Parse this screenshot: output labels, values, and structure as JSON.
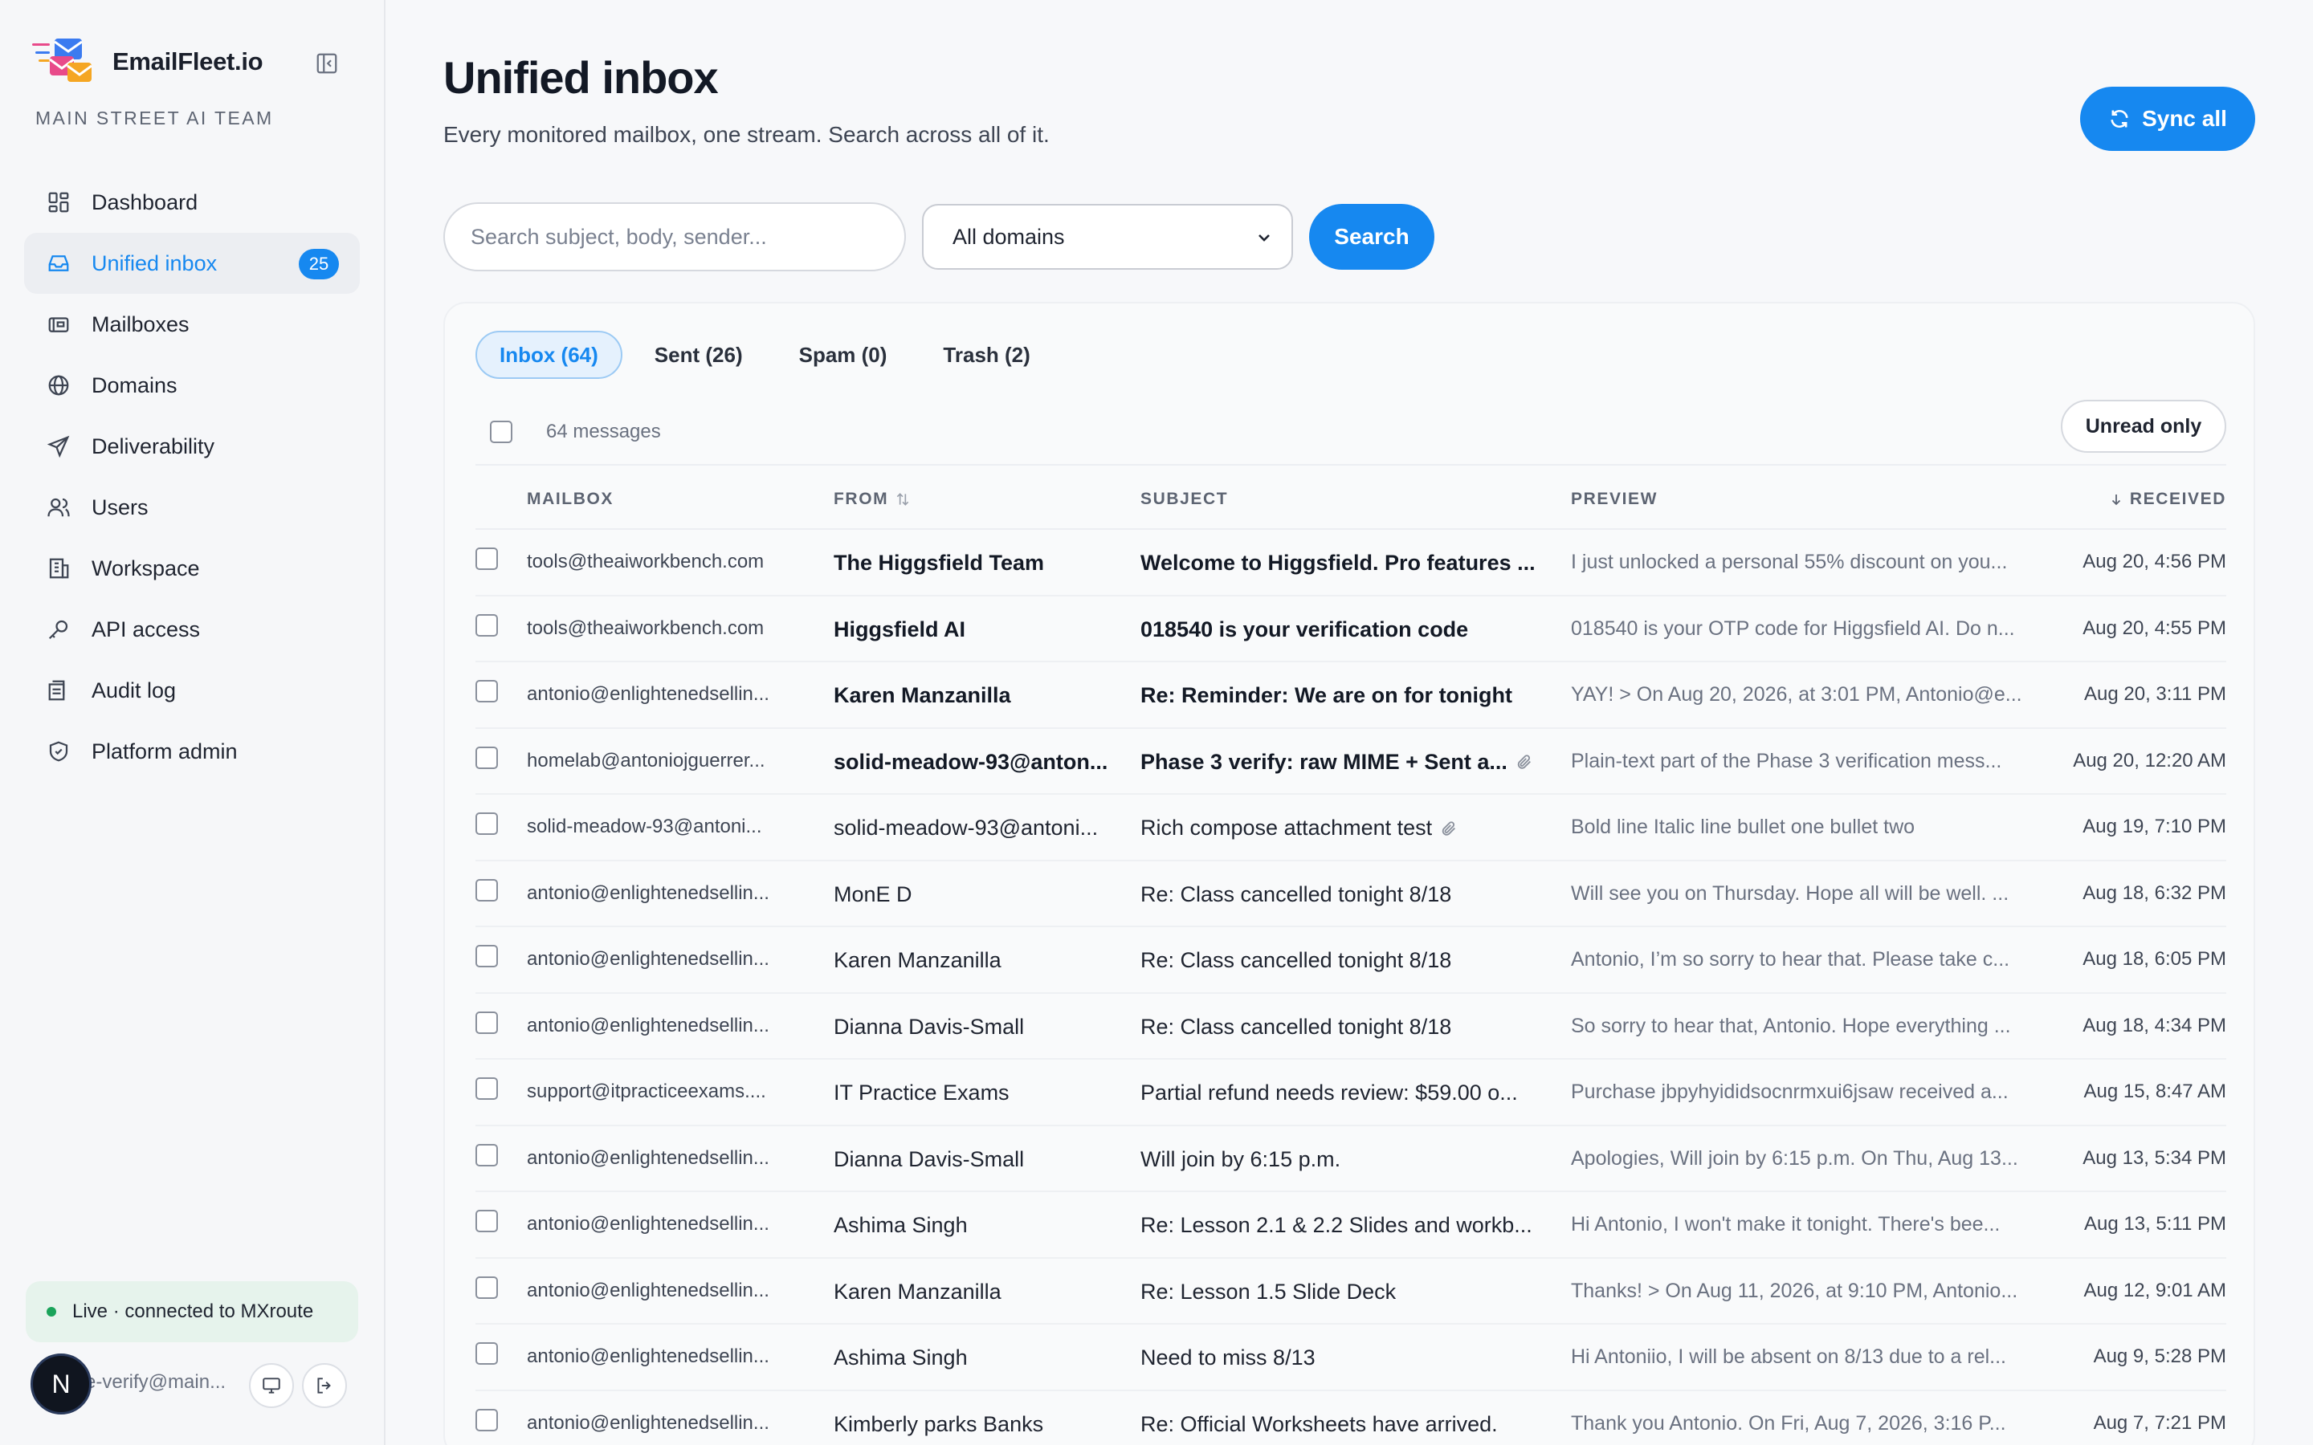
{
  "brand": {
    "name": "EmailFleet.io",
    "team": "MAIN STREET AI TEAM"
  },
  "colors": {
    "accent": "#1688f0",
    "status": "#1aa35a"
  },
  "nav": {
    "items": [
      {
        "label": "Dashboard",
        "icon": "dashboard-icon"
      },
      {
        "label": "Unified inbox",
        "icon": "inbox-icon",
        "badge": "25",
        "active": true
      },
      {
        "label": "Mailboxes",
        "icon": "mailbox-icon"
      },
      {
        "label": "Domains",
        "icon": "globe-icon"
      },
      {
        "label": "Deliverability",
        "icon": "send-icon"
      },
      {
        "label": "Users",
        "icon": "users-icon"
      },
      {
        "label": "Workspace",
        "icon": "building-icon"
      },
      {
        "label": "API access",
        "icon": "key-icon"
      },
      {
        "label": "Audit log",
        "icon": "log-icon"
      },
      {
        "label": "Platform admin",
        "icon": "shield-icon"
      }
    ]
  },
  "status": {
    "text": "Live · connected to MXroute"
  },
  "user": {
    "initial": "N",
    "email": "e-verify@main..."
  },
  "header": {
    "title": "Unified inbox",
    "subtitle": "Every monitored mailbox, one stream. Search across all of it.",
    "sync_label": "Sync all"
  },
  "search": {
    "placeholder": "Search subject, body, sender...",
    "domain_selected": "All domains",
    "button_label": "Search"
  },
  "tabs": [
    {
      "label": "Inbox (64)",
      "active": true
    },
    {
      "label": "Sent (26)"
    },
    {
      "label": "Spam (0)"
    },
    {
      "label": "Trash (2)"
    }
  ],
  "toolbar": {
    "count": "64 messages",
    "unread_label": "Unread only"
  },
  "table": {
    "columns": {
      "mailbox": "MAILBOX",
      "from": "FROM",
      "subject": "SUBJECT",
      "preview": "PREVIEW",
      "received": "RECEIVED"
    },
    "rows": [
      {
        "mailbox": "tools@theaiworkbench.com",
        "from": "The Higgsfield Team",
        "subject": "Welcome to Higgsfield. Pro features ...",
        "preview": "I just unlocked a personal 55% discount on you...",
        "received": "Aug 20, 4:56 PM",
        "unread": true,
        "attachment": false
      },
      {
        "mailbox": "tools@theaiworkbench.com",
        "from": "Higgsfield AI",
        "subject": "018540 is your verification code",
        "preview": "018540 is your OTP code for Higgsfield AI. Do n...",
        "received": "Aug 20, 4:55 PM",
        "unread": true,
        "attachment": false
      },
      {
        "mailbox": "antonio@enlightenedsellin...",
        "from": "Karen Manzanilla",
        "subject": "Re: Reminder: We are on for tonight",
        "preview": "YAY! > On Aug 20, 2026, at 3:01 PM, Antonio@e...",
        "received": "Aug 20, 3:11 PM",
        "unread": true,
        "attachment": false
      },
      {
        "mailbox": "homelab@antoniojguerrer...",
        "from": "solid-meadow-93@anton...",
        "subject": "Phase 3 verify: raw MIME + Sent a...",
        "preview": "Plain-text part of the Phase 3 verification mess...",
        "received": "Aug 20, 12:20 AM",
        "unread": true,
        "attachment": true
      },
      {
        "mailbox": "solid-meadow-93@antoni...",
        "from": "solid-meadow-93@antoni...",
        "subject": "Rich compose attachment test",
        "preview": "Bold line Italic line bullet one bullet two",
        "received": "Aug 19, 7:10 PM",
        "unread": false,
        "attachment": true
      },
      {
        "mailbox": "antonio@enlightenedsellin...",
        "from": "MonE D",
        "subject": "Re: Class cancelled tonight 8/18",
        "preview": "Will see you on Thursday. Hope all will be well. ...",
        "received": "Aug 18, 6:32 PM",
        "unread": false,
        "attachment": false
      },
      {
        "mailbox": "antonio@enlightenedsellin...",
        "from": "Karen Manzanilla",
        "subject": "Re: Class cancelled tonight 8/18",
        "preview": "Antonio, I’m so sorry to hear that. Please take c...",
        "received": "Aug 18, 6:05 PM",
        "unread": false,
        "attachment": false
      },
      {
        "mailbox": "antonio@enlightenedsellin...",
        "from": "Dianna Davis-Small",
        "subject": "Re: Class cancelled tonight 8/18",
        "preview": "So sorry to hear that, Antonio. Hope everything ...",
        "received": "Aug 18, 4:34 PM",
        "unread": false,
        "attachment": false
      },
      {
        "mailbox": "support@itpracticeexams....",
        "from": "IT Practice Exams",
        "subject": "Partial refund needs review: $59.00 o...",
        "preview": "Purchase jbpyhyididsocnrmxui6jsaw received a...",
        "received": "Aug 15, 8:47 AM",
        "unread": false,
        "attachment": false
      },
      {
        "mailbox": "antonio@enlightenedsellin...",
        "from": "Dianna Davis-Small",
        "subject": "Will join by 6:15 p.m.",
        "preview": "Apologies, Will join by 6:15 p.m. On Thu, Aug 13...",
        "received": "Aug 13, 5:34 PM",
        "unread": false,
        "attachment": false
      },
      {
        "mailbox": "antonio@enlightenedsellin...",
        "from": "Ashima Singh",
        "subject": "Re: Lesson 2.1 & 2.2 Slides and workb...",
        "preview": "Hi Antonio, I won't make it tonight. There's bee...",
        "received": "Aug 13, 5:11 PM",
        "unread": false,
        "attachment": false
      },
      {
        "mailbox": "antonio@enlightenedsellin...",
        "from": "Karen Manzanilla",
        "subject": "Re: Lesson 1.5 Slide Deck",
        "preview": "Thanks! > On Aug 11, 2026, at 9:10 PM, Antonio...",
        "received": "Aug 12, 9:01 AM",
        "unread": false,
        "attachment": false
      },
      {
        "mailbox": "antonio@enlightenedsellin...",
        "from": "Ashima Singh",
        "subject": "Need to miss 8/13",
        "preview": "Hi Antoniio, I will be absent on 8/13 due to a rel...",
        "received": "Aug 9, 5:28 PM",
        "unread": false,
        "attachment": false
      },
      {
        "mailbox": "antonio@enlightenedsellin...",
        "from": "Kimberly parks Banks",
        "subject": "Re: Official Worksheets have arrived.",
        "preview": "Thank you Antonio. On Fri, Aug 7, 2026, 3:16 P...",
        "received": "Aug 7, 7:21 PM",
        "unread": false,
        "attachment": false
      }
    ]
  }
}
